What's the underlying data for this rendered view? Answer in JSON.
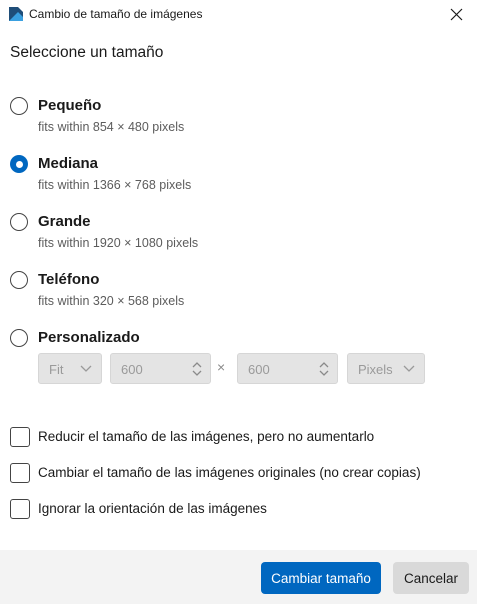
{
  "window": {
    "title": "Cambio de tamaño de imágenes",
    "app_icon": "image-resizer-icon",
    "close_icon": "close-icon"
  },
  "heading": "Seleccione un tamaño",
  "size_options": [
    {
      "label": "Pequeño",
      "description": "fits within 854 × 480 pixels",
      "selected": false
    },
    {
      "label": "Mediana",
      "description": "fits within 1366 × 768 pixels",
      "selected": true
    },
    {
      "label": "Grande",
      "description": "fits within 1920 × 1080 pixels",
      "selected": false
    },
    {
      "label": "Teléfono",
      "description": "fits within 320 × 568 pixels",
      "selected": false
    },
    {
      "label": "Personalizado",
      "selected": false
    }
  ],
  "custom": {
    "fit_mode": "Fit",
    "width": "600",
    "separator": "×",
    "height": "600",
    "unit": "Pixels",
    "enabled": false
  },
  "checkboxes": [
    {
      "label": "Reducir el tamaño de las imágenes, pero no aumentarlo",
      "checked": false
    },
    {
      "label": "Cambiar el tamaño de las imágenes originales (no crear copias)",
      "checked": false
    },
    {
      "label": "Ignorar la orientación de las imágenes",
      "checked": false
    }
  ],
  "buttons": {
    "primary": "Cambiar tamaño",
    "cancel": "Cancelar"
  },
  "colors": {
    "accent": "#0067c0",
    "footer_bg": "#f3f3f3",
    "disabled_ctrl": "#e4e4e4"
  }
}
